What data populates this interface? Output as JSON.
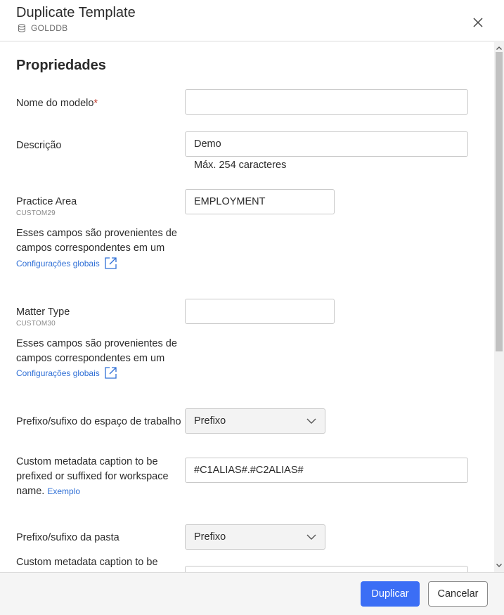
{
  "header": {
    "title": "Duplicate Template",
    "database": "GOLDDB"
  },
  "section": {
    "title": "Propriedades"
  },
  "fields": {
    "template_name": {
      "label": "Nome do modelo",
      "required_mark": "*",
      "value": ""
    },
    "description": {
      "label": "Descrição",
      "value": "Demo",
      "helper": "Máx. 254 caracteres"
    },
    "practice_area": {
      "label": "Practice Area",
      "code": "CUSTOM29",
      "value": "EMPLOYMENT",
      "note": "Esses campos são provenientes de campos correspondentes em um",
      "link": "Configurações globais"
    },
    "matter_type": {
      "label": "Matter Type",
      "code": "CUSTOM30",
      "value": "",
      "note": "Esses campos são provenientes de campos correspondentes em um",
      "link": "Configurações globais"
    },
    "workspace_prefix": {
      "label": "Prefixo/sufixo do espaço de trabalho",
      "selected": "Prefixo"
    },
    "workspace_caption": {
      "label": "Custom metadata caption to be prefixed or suffixed for workspace name.",
      "link": "Exemplo",
      "value": "#C1ALIAS#.#C2ALIAS#"
    },
    "folder_prefix": {
      "label": "Prefixo/sufixo da pasta",
      "selected": "Prefixo"
    },
    "folder_caption": {
      "label": "Custom metadata caption to be"
    }
  },
  "footer": {
    "primary_label": "Duplicar",
    "secondary_label": "Cancelar"
  },
  "colors": {
    "primary": "#3b6ef5",
    "link": "#2f6fd6",
    "required": "#c0392b"
  }
}
